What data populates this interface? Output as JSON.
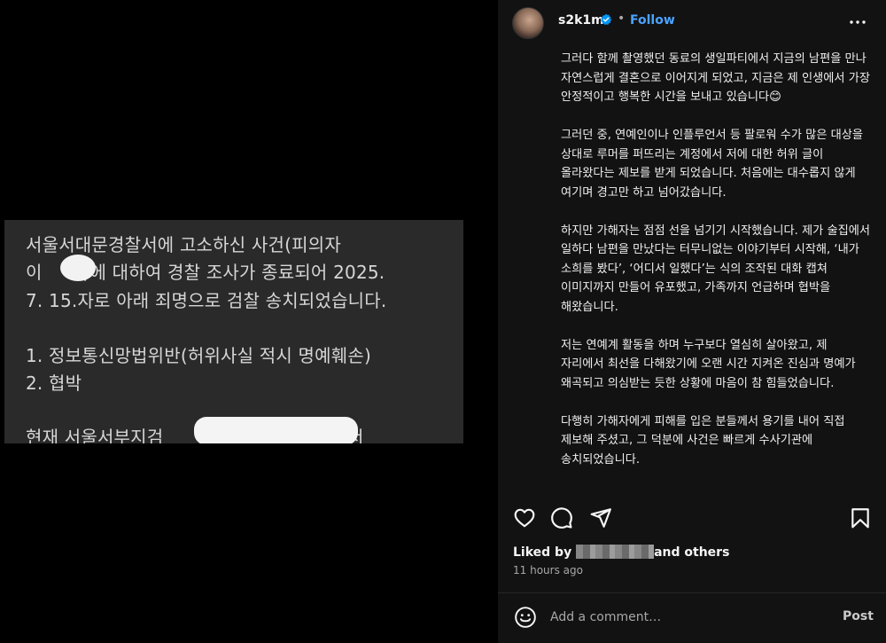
{
  "media": {
    "lines": [
      "서울서대문경찰서에 고소하신 사건(피의자",
      "이       )에 대하여 경찰 조사가 종료되어 2025.",
      "7. 15.자로 아래 죄명으로 검찰 송치되었습니다.",
      "1. 정보통신망법위반(허위사실 적시 명예훼손)",
      "2. 협박",
      "현재 서울서부지검                          부에서"
    ]
  },
  "header": {
    "username": "s2k1m",
    "separator": "•",
    "follow_label": "Follow"
  },
  "caption": {
    "paragraphs": [
      "그러다 함께 촬영했던 동료의 생일파티에서 지금의 남편을 만나 자연스럽게 결혼으로 이어지게 되었고, 지금은 제 인생에서 가장 안정적이고 행복한 시간을 보내고 있습니다😊",
      "그러던 중, 연예인이나 인플루언서 등 팔로워 수가 많은 대상을 상대로 루머를 퍼뜨리는 계정에서 저에 대한 허위 글이 올라왔다는 제보를 받게 되었습니다. 처음에는 대수롭지 않게 여기며 경고만 하고 넘어갔습니다.",
      "하지만 가해자는 점점 선을 넘기기 시작했습니다. 제가 술집에서 일하다 남편을 만났다는 터무니없는 이야기부터 시작해, ‘내가 소희를 봤다’, ‘어디서 일했다’는 식의 조작된 대화 캡쳐 이미지까지 만들어 유포했고, 가족까지 언급하며 협박을 해왔습니다.",
      "저는 연예계 활동을 하며 누구보다 열심히 살아왔고, 제 자리에서 최선을 다해왔기에 오랜 시간 지켜온 진심과 명예가 왜곡되고 의심받는 듯한 상황에 마음이 참 힘들었습니다.",
      "다행히 가해자에게 피해를 입은 분들께서 용기를 내어 직접 제보해 주셨고, 그 덕분에 사건은 빠르게 수사기관에 송치되었습니다."
    ]
  },
  "actions": {
    "like_icon": "heart-icon",
    "comment_icon": "comment-icon",
    "share_icon": "share-icon",
    "save_icon": "bookmark-icon"
  },
  "likes": {
    "prefix": "Liked by",
    "suffix": "and others"
  },
  "timestamp": "11 hours ago",
  "comment": {
    "placeholder": "Add a comment…",
    "post_label": "Post"
  },
  "colors": {
    "panel_bg": "#121212",
    "follow_blue": "#4aa3ff",
    "verified_blue": "#0095f6"
  }
}
